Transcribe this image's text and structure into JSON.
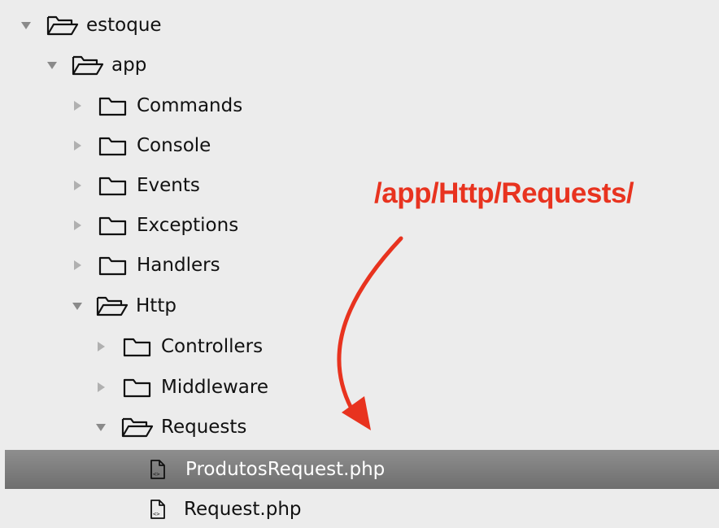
{
  "tree": {
    "items": [
      {
        "label": "estoque",
        "type": "folder",
        "expanded": true
      },
      {
        "label": "app",
        "type": "folder",
        "expanded": true
      },
      {
        "label": "Commands",
        "type": "folder",
        "expanded": false
      },
      {
        "label": "Console",
        "type": "folder",
        "expanded": false
      },
      {
        "label": "Events",
        "type": "folder",
        "expanded": false
      },
      {
        "label": "Exceptions",
        "type": "folder",
        "expanded": false
      },
      {
        "label": "Handlers",
        "type": "folder",
        "expanded": false
      },
      {
        "label": "Http",
        "type": "folder",
        "expanded": true
      },
      {
        "label": "Controllers",
        "type": "folder",
        "expanded": false
      },
      {
        "label": "Middleware",
        "type": "folder",
        "expanded": false
      },
      {
        "label": "Requests",
        "type": "folder",
        "expanded": true
      },
      {
        "label": "ProdutosRequest.php",
        "type": "file",
        "selected": true
      },
      {
        "label": "Request.php",
        "type": "file",
        "selected": false
      }
    ]
  },
  "annotation": {
    "text": "/app/Http/Requests/",
    "color": "#e8331f"
  },
  "colors": {
    "background": "#ececec",
    "selection": "#7d7d7d",
    "twisty": "#8a8a8a"
  }
}
